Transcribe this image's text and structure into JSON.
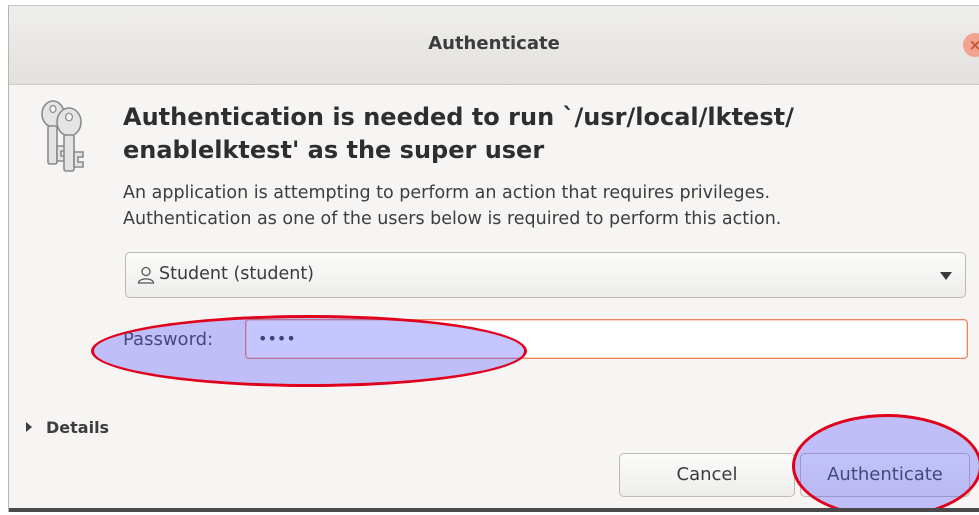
{
  "window": {
    "title": "Authenticate",
    "close_glyph": "×"
  },
  "heading": "Authentication is needed to run `/usr/local/lktest/ enablelktest' as the super user",
  "description": [
    "An application is attempting to perform an action that requires privileges.",
    "Authentication as one of the users below is required to perform this action."
  ],
  "user_select": {
    "selected": "Student (student)",
    "icon": "user-icon"
  },
  "password": {
    "label": "Password:",
    "masked_value": "••••"
  },
  "details": {
    "label": "Details"
  },
  "buttons": {
    "cancel": "Cancel",
    "authenticate": "Authenticate"
  },
  "colors": {
    "highlight_stroke": "#e0001b",
    "highlight_fill": "#5a5aff",
    "field_focus": "#e9855d"
  }
}
